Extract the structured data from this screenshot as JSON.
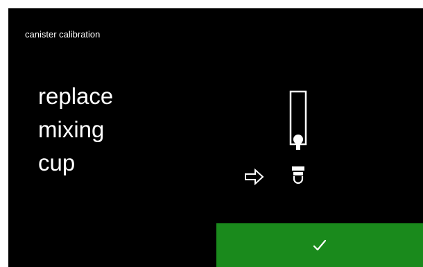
{
  "screen": {
    "title": "canister calibration",
    "instruction_lines": [
      "replace",
      "mixing",
      "cup"
    ]
  },
  "illustration": {
    "icons": [
      "right-arrow-icon",
      "canister-icon",
      "mixing-cup-icon"
    ]
  },
  "confirm": {
    "icon": "checkmark-icon",
    "accent_color": "#1a8a1c"
  }
}
